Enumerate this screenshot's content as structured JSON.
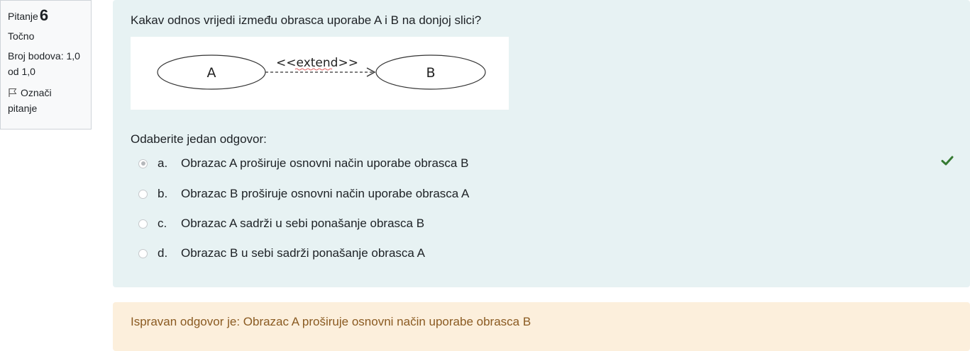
{
  "info": {
    "question_label": "Pitanje",
    "question_number": "6",
    "state": "Točno",
    "grade_line1": "Broj bodova: 1,0",
    "grade_line2": "od 1,0",
    "flag_line1": "Označi",
    "flag_line2": "pitanje",
    "flag_icon": "flag-icon"
  },
  "question": {
    "text": "Kakav odnos vrijedi između obrasca uporabe A i B na donjoj slici?",
    "diagram": {
      "left_label": "A",
      "right_label": "B",
      "relation_label": "<<extend>>"
    },
    "prompt": "Odaberite jedan odgovor:",
    "answers": [
      {
        "letter": "a.",
        "text": "Obrazac A proširuje osnovni način uporabe obrasca B",
        "selected": true
      },
      {
        "letter": "b.",
        "text": "Obrazac B proširuje osnovni način uporabe obrasca A",
        "selected": false
      },
      {
        "letter": "c.",
        "text": "Obrazac A sadrži u sebi ponašanje obrasca B",
        "selected": false
      },
      {
        "letter": "d.",
        "text": "Obrazac B u sebi sadrži ponašanje obrasca A",
        "selected": false
      }
    ],
    "correct_icon": "checkmark-icon",
    "correct_color": "#357a32"
  },
  "feedback": {
    "text": "Ispravan odgovor je: Obrazac A proširuje osnovni način uporabe obrasca B"
  }
}
